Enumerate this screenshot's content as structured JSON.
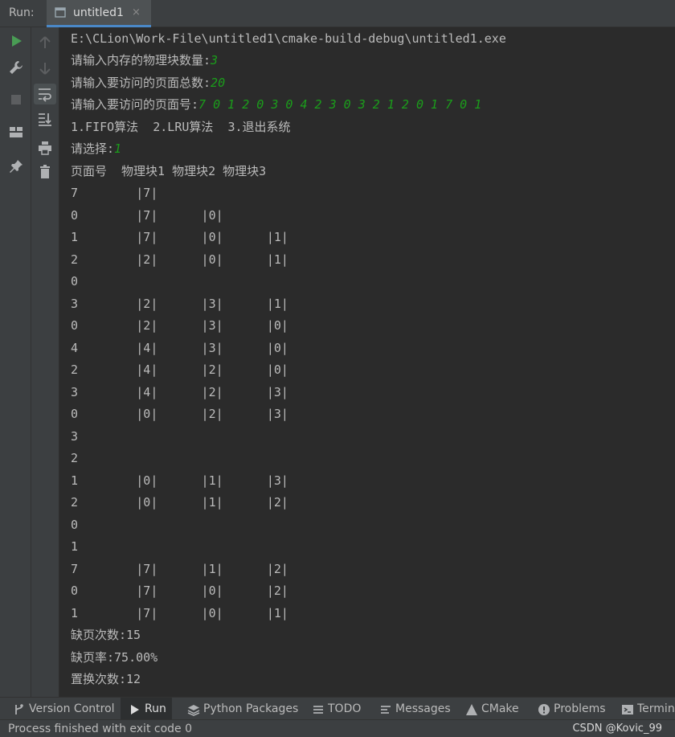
{
  "window": {
    "run_label": "Run:",
    "tab_title": "untitled1",
    "tab_close": "×"
  },
  "console": {
    "path": "E:\\CLion\\Work-File\\untitled1\\cmake-build-debug\\untitled1.exe",
    "prompt_blocks": "请输入内存的物理块数量:",
    "input_blocks": "3",
    "prompt_total": "请输入要访问的页面总数:",
    "input_total": "20",
    "prompt_pages": "请输入要访问的页面号:",
    "input_pages": "7 0 1 2 0 3 0 4 2 3 0 3 2 1 2 0 1 7 0 1",
    "menu": "1.FIFO算法  2.LRU算法  3.退出系统",
    "prompt_choice": "请选择:",
    "input_choice": "1",
    "table_header": "页面号  物理块1 物理块2 物理块3",
    "rows": [
      "7        |7|",
      "0        |7|      |0|",
      "1        |7|      |0|      |1|",
      "2        |2|      |0|      |1|",
      "0",
      "3        |2|      |3|      |1|",
      "0        |2|      |3|      |0|",
      "4        |4|      |3|      |0|",
      "2        |4|      |2|      |0|",
      "3        |4|      |2|      |3|",
      "0        |0|      |2|      |3|",
      "3",
      "2",
      "1        |0|      |1|      |3|",
      "2        |0|      |1|      |2|",
      "0",
      "1",
      "7        |7|      |1|      |2|",
      "0        |7|      |0|      |2|",
      "1        |7|      |0|      |1|"
    ],
    "fault_count": "缺页次数:15",
    "fault_rate": "缺页率:75.00%",
    "replace_count": "置换次数:12"
  },
  "bottom_tabs": [
    {
      "label": "Version Control",
      "icon": "branch-icon"
    },
    {
      "label": "Run",
      "icon": "play-icon"
    },
    {
      "label": "Python Packages",
      "icon": "layers-icon"
    },
    {
      "label": "TODO",
      "icon": "list-icon"
    },
    {
      "label": "Messages",
      "icon": "messages-icon"
    },
    {
      "label": "CMake",
      "icon": "triangle-icon"
    },
    {
      "label": "Problems",
      "icon": "info-icon"
    },
    {
      "label": "Terminal",
      "icon": "terminal-icon"
    }
  ],
  "status": {
    "message": "Process finished with exit code 0",
    "watermark": "CSDN @Kovic_99"
  },
  "colors": {
    "background": "#2b2b2b",
    "panel": "#3c3f41",
    "text": "#bbbbbb",
    "user_input": "#1b9d1b",
    "run_green": "#499c54",
    "accent": "#4a88c7"
  }
}
